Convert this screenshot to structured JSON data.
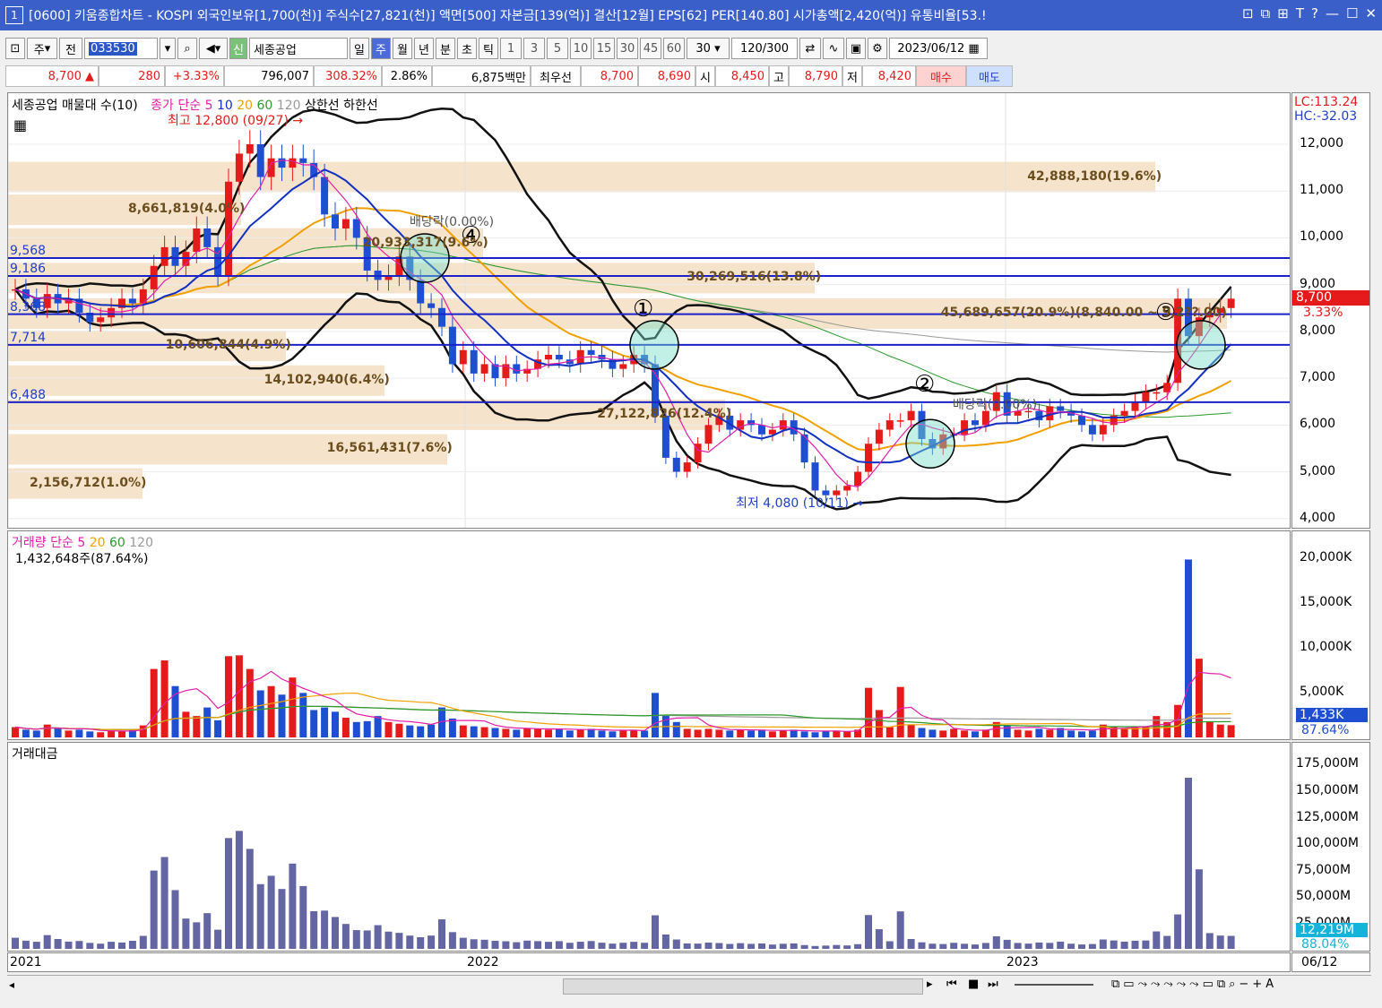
{
  "window": {
    "number": "1",
    "title": "[0600] 키움종합차트 - KOSPI 외국인보유[1,700(천)] 주식수[27,821(천)] 액면[500] 자본금[139(억)] 결산[12월] EPS[62] PER[140.80] 시가총액[2,420(억)] 유통비율[53.!",
    "buttons": [
      "⊡",
      "⧉",
      "⊞",
      "T",
      "?",
      "—",
      "☐",
      "✕"
    ]
  },
  "toolbar": {
    "market": "주",
    "all": "전",
    "code": "033530",
    "badge": "신",
    "stock_name": "세종공업",
    "periods": [
      "일",
      "주",
      "월",
      "년",
      "분",
      "초",
      "틱"
    ],
    "active_period": "주",
    "intervals": [
      "1",
      "3",
      "5",
      "10",
      "15",
      "30",
      "45",
      "60"
    ],
    "interval_select": "30",
    "count": "120/300",
    "date": "2023/06/12"
  },
  "quote": {
    "price": "8,700",
    "arrow": "▲",
    "change": "280",
    "change_pct": "+3.33%",
    "volume": "796,007",
    "vol_ratio": "308.32%",
    "turnover": "2.86%",
    "amount": "6,875백만",
    "best_label": "최우선",
    "best_ask": "8,700",
    "best_bid": "8,690",
    "open_label": "시",
    "open": "8,450",
    "high_label": "고",
    "high": "8,790",
    "low_label": "저",
    "low": "8,420",
    "buy": "매수",
    "sell": "매도"
  },
  "price_panel": {
    "legend1": "세종공업 매물대 수(10)",
    "legend2_prefix": "종가 단순",
    "legend2_periods": [
      "5",
      "10",
      "20",
      "60",
      "120"
    ],
    "legend2_suffix": "상한선 하한선",
    "high_note": "최고 12,800 (09/27) →",
    "low_note": "최저 4,080 (10/11) →",
    "dividend_notes": [
      "배당락(0.00%)",
      "배당락(0.00%)"
    ],
    "markers": [
      "①",
      "②",
      "③",
      "④"
    ],
    "volume_profile": [
      {
        "label": "42,888,180(19.6%)",
        "price": 11300
      },
      {
        "label": "8,661,819(4.0%)",
        "price": 10600
      },
      {
        "label": "20,933,317(9.6%)",
        "price": 9880
      },
      {
        "label": "30,269,516(13.8%)",
        "price": 9140
      },
      {
        "label": "45,689,657(20.9%)(8,840.00 ~ 9,2??.00)",
        "price": 8380
      },
      {
        "label": "10,606,844(4.9%)",
        "price": 7690
      },
      {
        "label": "14,102,940(6.4%)",
        "price": 6950
      },
      {
        "label": "27,122,826(12.4%)",
        "price": 6220
      },
      {
        "label": "16,561,431(7.6%)",
        "price": 5480
      },
      {
        "label": "2,156,712(1.0%)",
        "price": 4750
      }
    ],
    "hlines": [
      {
        "label": "9,568",
        "price": 9568
      },
      {
        "label": "9,186",
        "price": 9186
      },
      {
        "label": "8,368",
        "price": 8368
      },
      {
        "label": "7,714",
        "price": 7714
      },
      {
        "label": "6,488",
        "price": 6488
      }
    ],
    "axis_top": [
      "LC:113.24",
      "HC:-32.03"
    ],
    "axis_ticks": [
      "12,000",
      "11,000",
      "10,000",
      "9,000",
      "8,000",
      "7,000",
      "6,000",
      "5,000",
      "4,000"
    ],
    "current_price_tag": "8,700",
    "current_pct_tag": "3.33%"
  },
  "volume_panel": {
    "legend_prefix": "거래량 단순",
    "legend_periods": [
      "5",
      "20",
      "60",
      "120"
    ],
    "last_volume": "1,432,648주(87.64%)",
    "axis_ticks": [
      "20,000K",
      "15,000K",
      "10,000K",
      "5,000K"
    ],
    "tag_value": "1,433K",
    "tag_pct": "87.64%"
  },
  "amount_panel": {
    "legend": "거래대금",
    "axis_ticks": [
      "175,000M",
      "150,000M",
      "125,000M",
      "100,000M",
      "75,000M",
      "50,000M",
      "25,000M"
    ],
    "tag_value": "12,219M",
    "tag_pct": "88.04%"
  },
  "x_axis": {
    "labels": [
      "2021",
      "2022",
      "2023"
    ],
    "last_date": "06/12"
  },
  "colors": {
    "up": "#e51a1a",
    "down": "#1f4fd1",
    "bb": "#111111",
    "ma5": "#e01ea8",
    "ma10": "#1230c0",
    "ma20": "#f0a000",
    "ma60": "#2a9a2a",
    "ma120": "#999999",
    "hline": "#1a22c8",
    "profile": "#f6e3cc",
    "amount": "#6465a3"
  },
  "chart_data": {
    "type": "candlestick",
    "title": "세종공업 주봉",
    "y_range": [
      3900,
      12900
    ],
    "closes": [
      8900,
      8700,
      8500,
      8800,
      8600,
      8700,
      8400,
      8200,
      8300,
      8500,
      8700,
      8600,
      8900,
      9400,
      9800,
      9400,
      9700,
      10200,
      9800,
      9200,
      11200,
      11800,
      12000,
      11300,
      11700,
      11500,
      11700,
      11600,
      11300,
      10500,
      10200,
      10400,
      10000,
      9300,
      9100,
      9200,
      9600,
      9100,
      8600,
      8500,
      8100,
      7300,
      7600,
      7100,
      7300,
      7000,
      7300,
      7100,
      7200,
      7400,
      7500,
      7400,
      7300,
      7600,
      7500,
      7400,
      7200,
      7300,
      7500,
      7300,
      6200,
      5300,
      5000,
      5200,
      5600,
      6000,
      6200,
      5900,
      6100,
      6000,
      5800,
      5900,
      6100,
      5800,
      5200,
      4600,
      4500,
      4600,
      4700,
      5000,
      5600,
      5900,
      6100,
      6100,
      6300,
      5700,
      5500,
      5800,
      5800,
      6100,
      6000,
      6300,
      6700,
      6200,
      6300,
      6300,
      6100,
      6400,
      6300,
      6200,
      6000,
      5800,
      6000,
      6200,
      6300,
      6500,
      6700,
      6700,
      6900,
      8700,
      7900,
      8300,
      8400,
      8500,
      8700
    ],
    "volume_k": [
      1200,
      900,
      800,
      1500,
      1100,
      800,
      900,
      700,
      600,
      800,
      700,
      900,
      1400,
      8000,
      9000,
      6000,
      3000,
      2500,
      3500,
      2000,
      9500,
      9600,
      8000,
      5500,
      6000,
      5000,
      7000,
      5200,
      3200,
      3500,
      3000,
      2300,
      1800,
      1900,
      2500,
      1800,
      1600,
      1400,
      1300,
      1500,
      3500,
      2200,
      1400,
      1300,
      1200,
      1100,
      1000,
      900,
      1100,
      1000,
      900,
      1000,
      800,
      900,
      1000,
      800,
      700,
      800,
      900,
      800,
      5200,
      2600,
      1800,
      1000,
      900,
      1000,
      900,
      800,
      900,
      800,
      900,
      700,
      800,
      900,
      700,
      600,
      700,
      800,
      700,
      900,
      5800,
      3200,
      1200,
      5900,
      1500,
      1100,
      900,
      800,
      1000,
      800,
      700,
      900,
      1800,
      1400,
      900,
      800,
      1000,
      900,
      1100,
      800,
      700,
      800,
      1500,
      1300,
      1100,
      1200,
      1200,
      2500,
      1800,
      3800,
      20800,
      9200,
      1800,
      1500,
      1433
    ]
  }
}
